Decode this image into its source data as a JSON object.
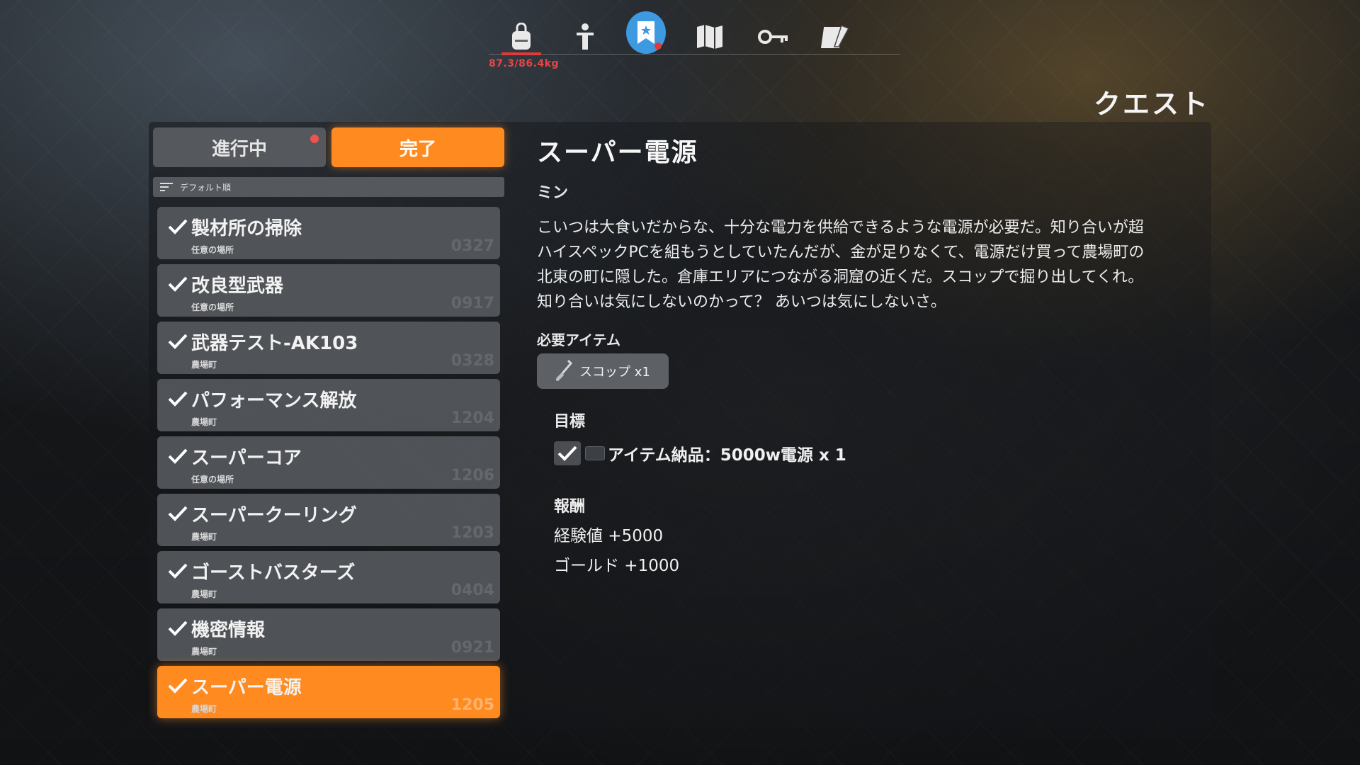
{
  "hud": {
    "weight": "87.3/86.4kg",
    "section_title": "クエスト",
    "nav_icons": [
      "backpack-icon",
      "character-icon",
      "quest-icon",
      "map-icon",
      "key-icon",
      "notes-icon"
    ]
  },
  "tabs": {
    "in_progress": "進行中",
    "completed": "完了"
  },
  "sort": {
    "label": "デフォルト順"
  },
  "quests": [
    {
      "name": "製材所の掃除",
      "location": "任意の場所",
      "id": "0327"
    },
    {
      "name": "改良型武器",
      "location": "任意の場所",
      "id": "0917"
    },
    {
      "name": "武器テスト-AK103",
      "location": "農場町",
      "id": "0328"
    },
    {
      "name": "パフォーマンス解放",
      "location": "農場町",
      "id": "1204"
    },
    {
      "name": "スーパーコア",
      "location": "任意の場所",
      "id": "1206"
    },
    {
      "name": "スーパークーリング",
      "location": "農場町",
      "id": "1203"
    },
    {
      "name": "ゴーストバスターズ",
      "location": "農場町",
      "id": "0404"
    },
    {
      "name": "機密情報",
      "location": "農場町",
      "id": "0921"
    },
    {
      "name": "スーパー電源",
      "location": "農場町",
      "id": "1205"
    }
  ],
  "detail": {
    "title": "スーパー電源",
    "giver": "ミン",
    "description": "こいつは大食いだからな、十分な電力を供給できるような電源が必要だ。知り合いが超\nハイスペックPCを組もうとしていたんだが、金が足りなくて、電源だけ買って農場町の\n北東の町に隠した。倉庫エリアにつながる洞窟の近くだ。スコップで掘り出してくれ。\n知り合いは気にしないのかって？ あいつは気にしないさ。",
    "required_label": "必要アイテム",
    "required_item": "スコップ x1",
    "objective_label": "目標",
    "objective": "アイテム納品：5000w電源 x 1",
    "reward_label": "報酬",
    "reward_exp": "経験値 +5000",
    "reward_gold": "ゴールド +1000"
  },
  "colors": {
    "accent_orange": "#ff8a1f",
    "nav_active": "#3d9ae0",
    "weight_red": "#e84545"
  }
}
